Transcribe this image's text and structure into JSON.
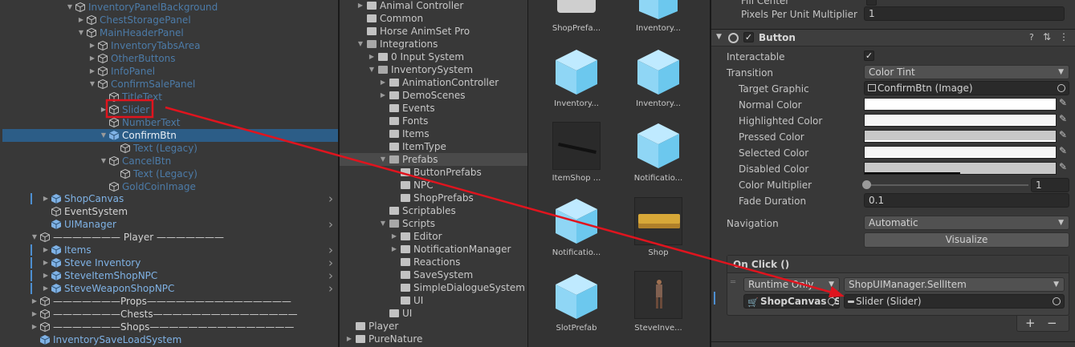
{
  "hierarchy": {
    "items": [
      {
        "label": "InventoryPanelBackground",
        "style": "blue-dim"
      },
      {
        "label": "ChestStoragePanel",
        "style": "blue-dim"
      },
      {
        "label": "MainHeaderPanel",
        "style": "blue-dim"
      },
      {
        "label": "InventoryTabsArea",
        "style": "blue-dim"
      },
      {
        "label": "OtherButtons",
        "style": "blue-dim"
      },
      {
        "label": "InfoPanel",
        "style": "blue-dim"
      },
      {
        "label": "ConfirmSalePanel",
        "style": "blue-dim"
      },
      {
        "label": "TitleText",
        "style": "blue-dim"
      },
      {
        "label": "Slider",
        "style": "blue-dim"
      },
      {
        "label": "NumberText",
        "style": "blue-dim"
      },
      {
        "label": "ConfirmBtn",
        "style": "blue"
      },
      {
        "label": "Text (Legacy)",
        "style": "blue-dim"
      },
      {
        "label": "CancelBtn",
        "style": "blue-dim"
      },
      {
        "label": "Text (Legacy)",
        "style": "blue-dim"
      },
      {
        "label": "GoldCoinImage",
        "style": "blue-dim"
      },
      {
        "label": "ShopCanvas",
        "style": "blue"
      },
      {
        "label": "EventSystem",
        "style": "white"
      },
      {
        "label": "UIManager",
        "style": "blue"
      },
      {
        "label": "——————— Player ———————",
        "style": "white"
      },
      {
        "label": "Items",
        "style": "blue"
      },
      {
        "label": "Steve Inventory",
        "style": "blue"
      },
      {
        "label": "SteveItemShopNPC",
        "style": "blue"
      },
      {
        "label": "SteveWeaponShopNPC",
        "style": "blue"
      },
      {
        "label": "———————Props———————————————",
        "style": "white"
      },
      {
        "label": "———————Chests———————————————",
        "style": "white"
      },
      {
        "label": "———————Shops———————————————",
        "style": "white"
      },
      {
        "label": "InventorySaveLoadSystem",
        "style": "blue"
      }
    ]
  },
  "project": {
    "folders": [
      {
        "label": "Animal Controller"
      },
      {
        "label": "Common"
      },
      {
        "label": "Horse AnimSet Pro"
      },
      {
        "label": "Integrations"
      },
      {
        "label": "0 Input System"
      },
      {
        "label": "InventorySystem"
      },
      {
        "label": "AnimationController"
      },
      {
        "label": "DemoScenes"
      },
      {
        "label": "Events"
      },
      {
        "label": "Fonts"
      },
      {
        "label": "Items"
      },
      {
        "label": "ItemType"
      },
      {
        "label": "Prefabs"
      },
      {
        "label": "ButtonPrefabs"
      },
      {
        "label": "NPC"
      },
      {
        "label": "ShopPrefabs"
      },
      {
        "label": "Scriptables"
      },
      {
        "label": "Scripts"
      },
      {
        "label": "Editor"
      },
      {
        "label": "NotificationManager"
      },
      {
        "label": "Reactions"
      },
      {
        "label": "SaveSystem"
      },
      {
        "label": "SimpleDialogueSystem"
      },
      {
        "label": "UI"
      },
      {
        "label": "UI"
      },
      {
        "label": "Player"
      },
      {
        "label": "PureNature"
      }
    ]
  },
  "assets": {
    "items": [
      {
        "label": "ShopPrefa...",
        "icon": "grey-prefab-icon"
      },
      {
        "label": "Inventory...",
        "icon": "prefab-cube-icon"
      },
      {
        "label": "Inventory...",
        "icon": "prefab-cube-icon"
      },
      {
        "label": "Inventory...",
        "icon": "prefab-cube-icon"
      },
      {
        "label": "ItemShop ...",
        "icon": "stick-model-icon"
      },
      {
        "label": "Notificatio...",
        "icon": "prefab-cube-icon"
      },
      {
        "label": "Notificatio...",
        "icon": "prefab-cube-icon"
      },
      {
        "label": "Shop",
        "icon": "counter-model-icon"
      },
      {
        "label": "SlotPrefab",
        "icon": "prefab-cube-icon"
      },
      {
        "label": "SteveInve...",
        "icon": "character-model-icon"
      }
    ]
  },
  "inspector": {
    "pivot_label": "Fill Center",
    "pixels_label": "Pixels Per Unit Multiplier",
    "pixels_value": "1",
    "component_title": "Button",
    "interactable_label": "Interactable",
    "interactable_value": "✓",
    "transition_label": "Transition",
    "transition_value": "Color Tint",
    "target_graphic_label": "Target Graphic",
    "target_graphic_value": "ConfirmBtn (Image)",
    "normal_label": "Normal Color",
    "highlighted_label": "Highlighted Color",
    "pressed_label": "Pressed Color",
    "selected_label": "Selected Color",
    "disabled_label": "Disabled Color",
    "multiplier_label": "Color Multiplier",
    "multiplier_value": "1",
    "fade_label": "Fade Duration",
    "fade_value": "0.1",
    "navigation_label": "Navigation",
    "navigation_value": "Automatic",
    "visualize_label": "Visualize",
    "onclick_title": "On Click ()",
    "runtime_value": "Runtime Only",
    "function_value": "ShopUIManager.SellItem",
    "object_value": "ShopCanvas (S",
    "argument_value": "Slider (Slider)",
    "plus_label": "+",
    "minus_label": "−",
    "colors": {
      "normal": "#ffffff",
      "highlighted": "#f5f5f5",
      "pressed": "#c8c8c8",
      "selected": "#f5f5f5",
      "disabled": "#c8c8c8"
    }
  },
  "colors": {
    "annotation_red": "#e0141e",
    "selection_blue": "#2c5d87"
  }
}
